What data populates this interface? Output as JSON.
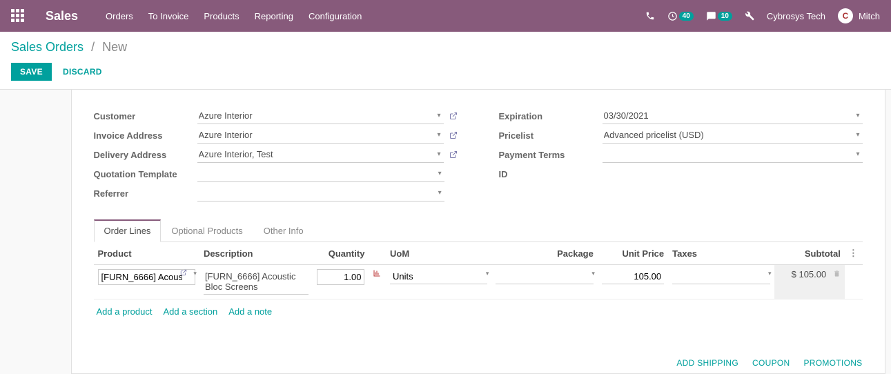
{
  "navbar": {
    "brand": "Sales",
    "menu": [
      "Orders",
      "To Invoice",
      "Products",
      "Reporting",
      "Configuration"
    ],
    "activities_count": "40",
    "messages_count": "10",
    "company": "Cybrosys Tech",
    "user_short": "Mitch",
    "avatar_letter": "C"
  },
  "breadcrumb": {
    "root": "Sales Orders",
    "current": "New"
  },
  "actions": {
    "save": "SAVE",
    "discard": "DISCARD"
  },
  "form": {
    "left": {
      "customer_label": "Customer",
      "customer_value": "Azure Interior",
      "invoice_addr_label": "Invoice Address",
      "invoice_addr_value": "Azure Interior",
      "delivery_addr_label": "Delivery Address",
      "delivery_addr_value": "Azure Interior, Test",
      "quotation_tpl_label": "Quotation Template",
      "quotation_tpl_value": "",
      "referrer_label": "Referrer",
      "referrer_value": ""
    },
    "right": {
      "expiration_label": "Expiration",
      "expiration_value": "03/30/2021",
      "pricelist_label": "Pricelist",
      "pricelist_value": "Advanced pricelist (USD)",
      "payment_terms_label": "Payment Terms",
      "payment_terms_value": "",
      "id_label": "ID",
      "id_value": ""
    }
  },
  "tabs": {
    "order_lines": "Order Lines",
    "optional_products": "Optional Products",
    "other_info": "Other Info"
  },
  "table": {
    "headers": {
      "product": "Product",
      "description": "Description",
      "quantity": "Quantity",
      "uom": "UoM",
      "package": "Package",
      "unit_price": "Unit Price",
      "taxes": "Taxes",
      "subtotal": "Subtotal"
    },
    "row1": {
      "product": "[FURN_6666] Acous",
      "description": "[FURN_6666] Acoustic Bloc Screens",
      "quantity": "1.00",
      "uom": "Units",
      "package": "",
      "unit_price": "105.00",
      "taxes": "",
      "subtotal": "$ 105.00"
    },
    "add_product": "Add a product",
    "add_section": "Add a section",
    "add_note": "Add a note"
  },
  "footer": {
    "add_shipping": "ADD SHIPPING",
    "coupon": "COUPON",
    "promotions": "PROMOTIONS"
  }
}
